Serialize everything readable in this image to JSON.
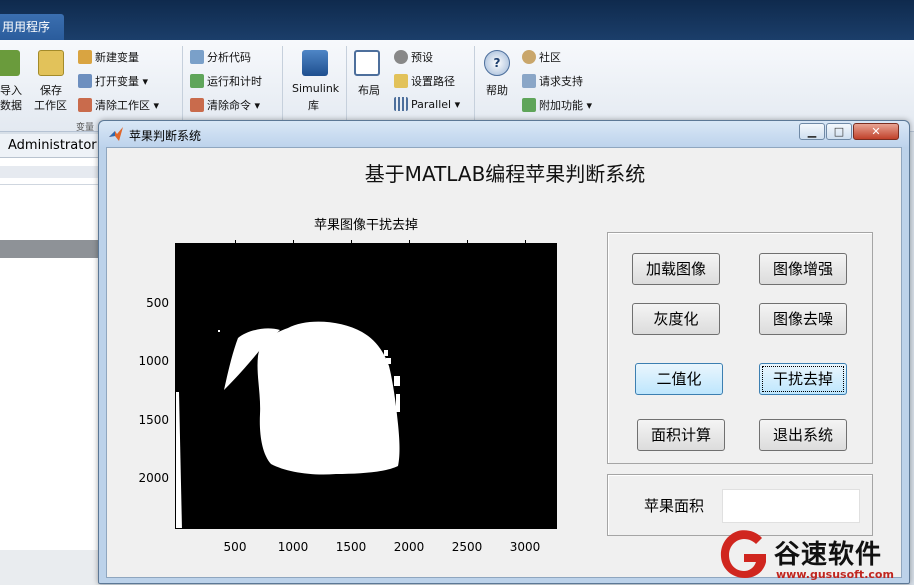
{
  "matlab": {
    "tab_label": "用用程序",
    "ribbon": {
      "import_label_1": "导入",
      "import_label_2": "数据",
      "save_label_1": "保存",
      "save_label_2": "工作区",
      "new_variable": "新建变量",
      "open_variable": "打开变量",
      "clear_workspace": "清除工作区",
      "group_variable": "变量",
      "analyze_code": "分析代码",
      "run_and_time": "运行和计时",
      "clear_commands": "清除命令",
      "simulink_1": "Simulink",
      "simulink_2": "库",
      "layout": "布局",
      "preferences": "预设",
      "set_path": "设置路径",
      "parallel": "Parallel",
      "help": "帮助",
      "community": "社区",
      "request_support": "请求支持",
      "addons": "附加功能"
    },
    "address": "Administrator"
  },
  "figure": {
    "window_title": "苹果判断系统",
    "main_title": "基于MATLAB编程苹果判断系统",
    "axes": {
      "title": "苹果图像干扰去掉",
      "y_ticks": [
        "500",
        "1000",
        "1500",
        "2000"
      ],
      "x_ticks": [
        "500",
        "1000",
        "1500",
        "2000",
        "2500",
        "3000"
      ]
    },
    "buttons": {
      "load_image": "加载图像",
      "enhance_image": "图像增强",
      "grayscale": "灰度化",
      "denoise": "图像去噪",
      "binarize": "二值化",
      "remove_interference": "干扰去掉",
      "area_calc": "面积计算",
      "exit": "退出系统"
    },
    "area_label": "苹果面积",
    "area_value": ""
  },
  "watermark": {
    "text": "谷速软件",
    "url": "www.gususoft.com"
  },
  "colors": {
    "matlab_title": "#0f2a4d",
    "window_frame": "#bcd2ea",
    "figure_bg": "#f0f0f0",
    "watermark_red": "#c0251f"
  }
}
